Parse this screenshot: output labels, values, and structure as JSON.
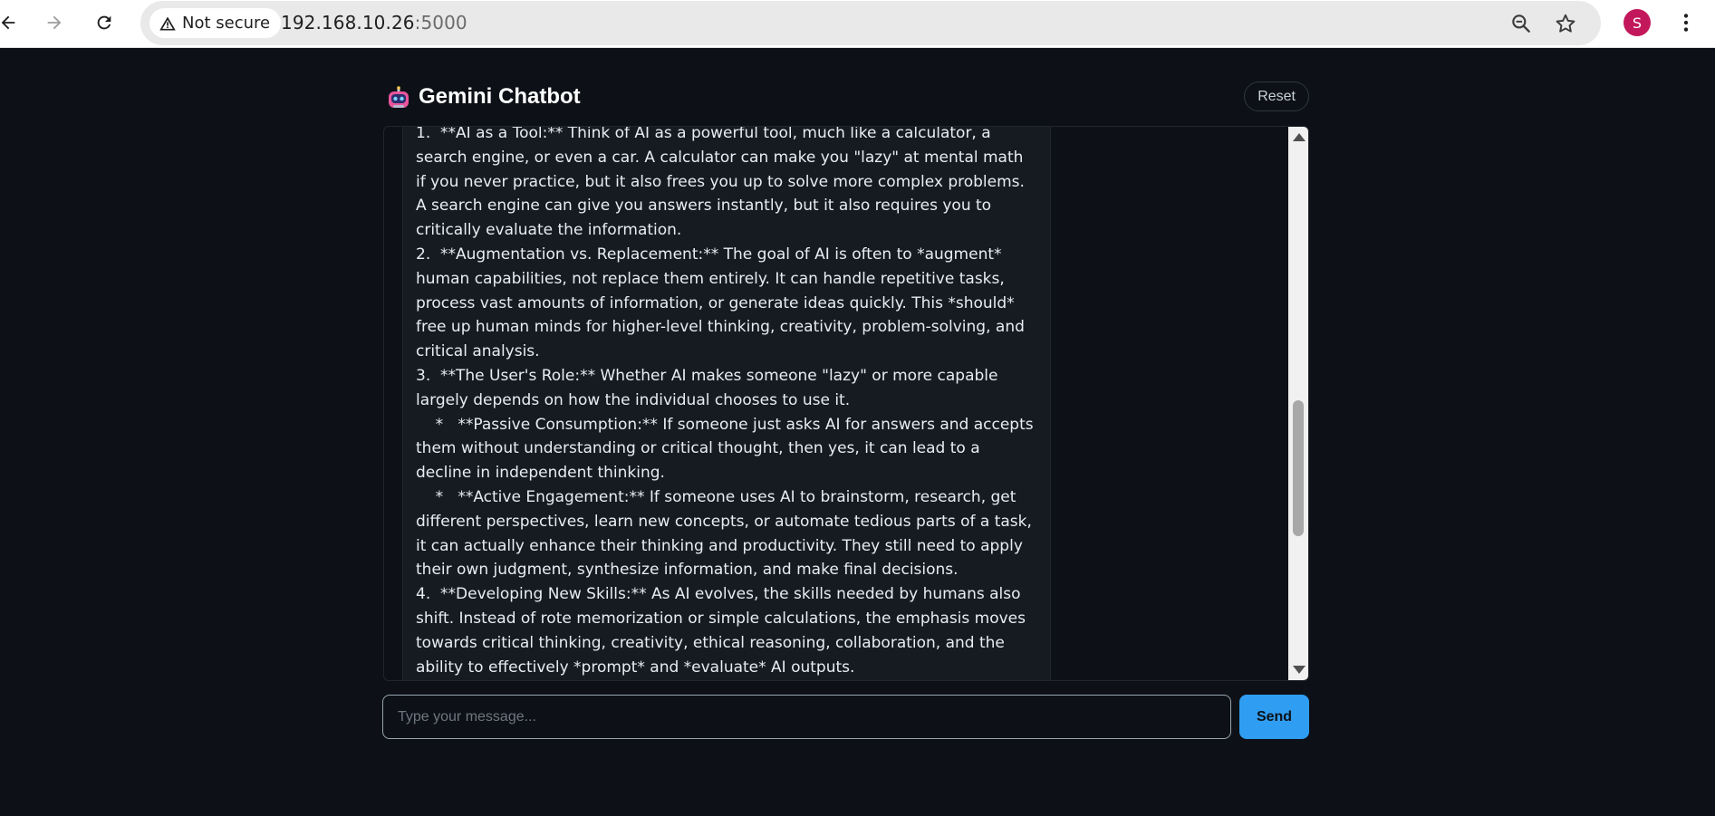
{
  "browser": {
    "security_label": "Not secure",
    "url_host": "192.168.10.26",
    "url_port": ":5000",
    "profile_initial": "S",
    "icons": [
      "back-arrow-icon",
      "forward-arrow-icon",
      "reload-icon",
      "warning-icon",
      "zoom-icon",
      "star-icon",
      "more-vert-icon"
    ]
  },
  "app": {
    "title": "Gemini Chatbot",
    "logo_icon": "robot-icon",
    "reset_label": "Reset",
    "input_placeholder": "Type your message...",
    "send_label": "Send"
  },
  "messages": [
    {
      "role": "bot",
      "paragraphs": [
        "1.  **AI as a Tool:** Think of AI as a powerful tool, much like a calculator, a search engine, or even a car. A calculator can make you \"lazy\" at mental math if you never practice, but it also frees you up to solve more complex problems. A search engine can give you answers instantly, but it also requires you to critically evaluate the information.",
        "2.  **Augmentation vs. Replacement:** The goal of AI is often to *augment* human capabilities, not replace them entirely. It can handle repetitive tasks, process vast amounts of information, or generate ideas quickly. This *should* free up human minds for higher-level thinking, creativity, problem-solving, and critical analysis.",
        "3.  **The User's Role:** Whether AI makes someone \"lazy\" or more capable largely depends on how the individual chooses to use it.",
        "    *   **Passive Consumption:** If someone just asks AI for answers and accepts them without understanding or critical thought, then yes, it can lead to a decline in independent thinking.",
        "    *   **Active Engagement:** If someone uses AI to brainstorm, research, get different perspectives, learn new concepts, or automate tedious parts of a task, it can actually enhance their thinking and productivity. They still need to apply their own judgment, synthesize information, and make final decisions.",
        "4.  **Developing New Skills:** As AI evolves, the skills needed by humans also shift. Instead of rote memorization or simple calculations, the emphasis moves towards critical thinking, creativity, ethical reasoning, collaboration, and the ability to effectively *prompt* and *evaluate* AI outputs."
      ]
    }
  ]
}
